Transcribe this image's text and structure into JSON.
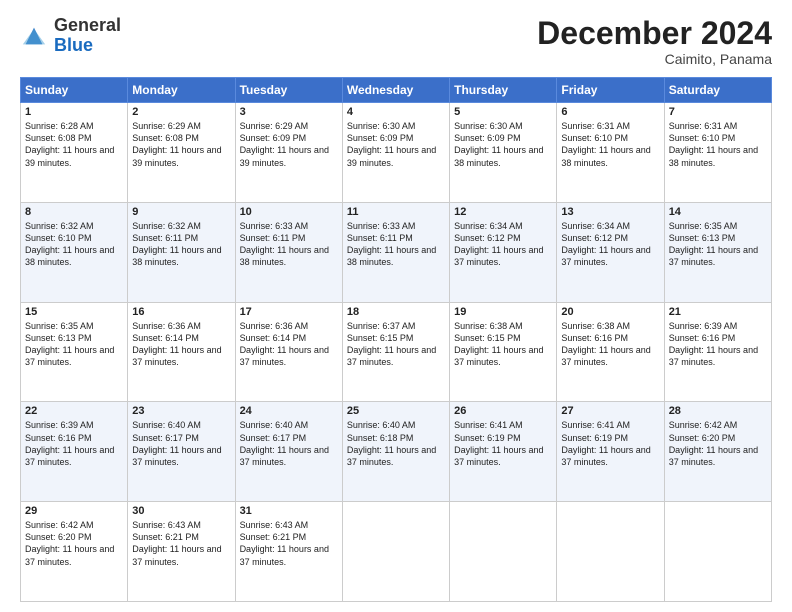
{
  "header": {
    "logo_line1": "General",
    "logo_line2": "Blue",
    "month_title": "December 2024",
    "subtitle": "Caimito, Panama"
  },
  "weekdays": [
    "Sunday",
    "Monday",
    "Tuesday",
    "Wednesday",
    "Thursday",
    "Friday",
    "Saturday"
  ],
  "weeks": [
    [
      {
        "day": "1",
        "sunrise": "6:28 AM",
        "sunset": "6:08 PM",
        "daylight": "11 hours and 39 minutes."
      },
      {
        "day": "2",
        "sunrise": "6:29 AM",
        "sunset": "6:08 PM",
        "daylight": "11 hours and 39 minutes."
      },
      {
        "day": "3",
        "sunrise": "6:29 AM",
        "sunset": "6:09 PM",
        "daylight": "11 hours and 39 minutes."
      },
      {
        "day": "4",
        "sunrise": "6:30 AM",
        "sunset": "6:09 PM",
        "daylight": "11 hours and 39 minutes."
      },
      {
        "day": "5",
        "sunrise": "6:30 AM",
        "sunset": "6:09 PM",
        "daylight": "11 hours and 38 minutes."
      },
      {
        "day": "6",
        "sunrise": "6:31 AM",
        "sunset": "6:10 PM",
        "daylight": "11 hours and 38 minutes."
      },
      {
        "day": "7",
        "sunrise": "6:31 AM",
        "sunset": "6:10 PM",
        "daylight": "11 hours and 38 minutes."
      }
    ],
    [
      {
        "day": "8",
        "sunrise": "6:32 AM",
        "sunset": "6:10 PM",
        "daylight": "11 hours and 38 minutes."
      },
      {
        "day": "9",
        "sunrise": "6:32 AM",
        "sunset": "6:11 PM",
        "daylight": "11 hours and 38 minutes."
      },
      {
        "day": "10",
        "sunrise": "6:33 AM",
        "sunset": "6:11 PM",
        "daylight": "11 hours and 38 minutes."
      },
      {
        "day": "11",
        "sunrise": "6:33 AM",
        "sunset": "6:11 PM",
        "daylight": "11 hours and 38 minutes."
      },
      {
        "day": "12",
        "sunrise": "6:34 AM",
        "sunset": "6:12 PM",
        "daylight": "11 hours and 37 minutes."
      },
      {
        "day": "13",
        "sunrise": "6:34 AM",
        "sunset": "6:12 PM",
        "daylight": "11 hours and 37 minutes."
      },
      {
        "day": "14",
        "sunrise": "6:35 AM",
        "sunset": "6:13 PM",
        "daylight": "11 hours and 37 minutes."
      }
    ],
    [
      {
        "day": "15",
        "sunrise": "6:35 AM",
        "sunset": "6:13 PM",
        "daylight": "11 hours and 37 minutes."
      },
      {
        "day": "16",
        "sunrise": "6:36 AM",
        "sunset": "6:14 PM",
        "daylight": "11 hours and 37 minutes."
      },
      {
        "day": "17",
        "sunrise": "6:36 AM",
        "sunset": "6:14 PM",
        "daylight": "11 hours and 37 minutes."
      },
      {
        "day": "18",
        "sunrise": "6:37 AM",
        "sunset": "6:15 PM",
        "daylight": "11 hours and 37 minutes."
      },
      {
        "day": "19",
        "sunrise": "6:38 AM",
        "sunset": "6:15 PM",
        "daylight": "11 hours and 37 minutes."
      },
      {
        "day": "20",
        "sunrise": "6:38 AM",
        "sunset": "6:16 PM",
        "daylight": "11 hours and 37 minutes."
      },
      {
        "day": "21",
        "sunrise": "6:39 AM",
        "sunset": "6:16 PM",
        "daylight": "11 hours and 37 minutes."
      }
    ],
    [
      {
        "day": "22",
        "sunrise": "6:39 AM",
        "sunset": "6:16 PM",
        "daylight": "11 hours and 37 minutes."
      },
      {
        "day": "23",
        "sunrise": "6:40 AM",
        "sunset": "6:17 PM",
        "daylight": "11 hours and 37 minutes."
      },
      {
        "day": "24",
        "sunrise": "6:40 AM",
        "sunset": "6:17 PM",
        "daylight": "11 hours and 37 minutes."
      },
      {
        "day": "25",
        "sunrise": "6:40 AM",
        "sunset": "6:18 PM",
        "daylight": "11 hours and 37 minutes."
      },
      {
        "day": "26",
        "sunrise": "6:41 AM",
        "sunset": "6:19 PM",
        "daylight": "11 hours and 37 minutes."
      },
      {
        "day": "27",
        "sunrise": "6:41 AM",
        "sunset": "6:19 PM",
        "daylight": "11 hours and 37 minutes."
      },
      {
        "day": "28",
        "sunrise": "6:42 AM",
        "sunset": "6:20 PM",
        "daylight": "11 hours and 37 minutes."
      }
    ],
    [
      {
        "day": "29",
        "sunrise": "6:42 AM",
        "sunset": "6:20 PM",
        "daylight": "11 hours and 37 minutes."
      },
      {
        "day": "30",
        "sunrise": "6:43 AM",
        "sunset": "6:21 PM",
        "daylight": "11 hours and 37 minutes."
      },
      {
        "day": "31",
        "sunrise": "6:43 AM",
        "sunset": "6:21 PM",
        "daylight": "11 hours and 37 minutes."
      },
      null,
      null,
      null,
      null
    ]
  ]
}
